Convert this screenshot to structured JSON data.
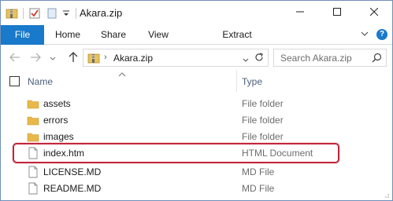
{
  "window": {
    "title": "Akara.zip"
  },
  "ribbon": {
    "tabs": [
      "File",
      "Home",
      "Share",
      "View",
      "Extract"
    ]
  },
  "address": {
    "path": "Akara.zip",
    "search_placeholder": "Search Akara.zip"
  },
  "columns": {
    "name": "Name",
    "type": "Type"
  },
  "files": [
    {
      "name": "assets",
      "type": "File folder",
      "icon": "folder-icon"
    },
    {
      "name": "errors",
      "type": "File folder",
      "icon": "folder-icon"
    },
    {
      "name": "images",
      "type": "File folder",
      "icon": "folder-icon"
    },
    {
      "name": "index.htm",
      "type": "HTML Document",
      "icon": "document-icon",
      "highlighted": true
    },
    {
      "name": "LICENSE.MD",
      "type": "MD File",
      "icon": "document-icon"
    },
    {
      "name": "README.MD",
      "type": "MD File",
      "icon": "document-icon"
    }
  ],
  "colors": {
    "accent": "#1979ca",
    "highlight": "#c0263a",
    "folder": "#e8b84a"
  }
}
